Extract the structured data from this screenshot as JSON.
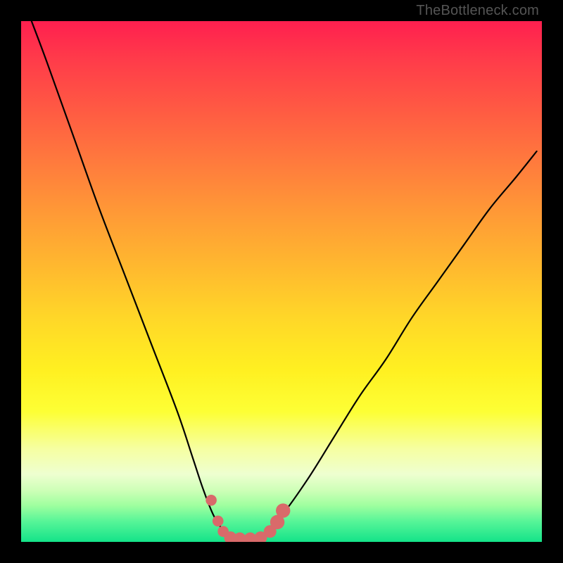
{
  "watermark": {
    "text": "TheBottleneck.com"
  },
  "chart_data": {
    "type": "line",
    "title": "",
    "xlabel": "",
    "ylabel": "",
    "xlim": [
      0,
      100
    ],
    "ylim": [
      0,
      100
    ],
    "grid": false,
    "legend": false,
    "series": [
      {
        "name": "bottleneck-curve",
        "x": [
          2,
          5,
          10,
          15,
          20,
          25,
          30,
          33,
          35,
          37,
          39,
          41,
          43,
          45,
          47,
          50,
          55,
          60,
          65,
          70,
          75,
          80,
          85,
          90,
          95,
          99
        ],
        "values": [
          100,
          92,
          78,
          64,
          51,
          38,
          25,
          16,
          10,
          5,
          2,
          0.5,
          0.5,
          0.5,
          2,
          5,
          12,
          20,
          28,
          35,
          43,
          50,
          57,
          64,
          70,
          75
        ]
      }
    ],
    "markers": {
      "name": "flat-bottom-dots",
      "color": "#d96a6a",
      "points": [
        {
          "x": 36.5,
          "y": 8.0,
          "r": 1.3
        },
        {
          "x": 37.8,
          "y": 4.0,
          "r": 1.3
        },
        {
          "x": 38.8,
          "y": 2.0,
          "r": 1.3
        },
        {
          "x": 40.2,
          "y": 0.8,
          "r": 1.5
        },
        {
          "x": 42.0,
          "y": 0.6,
          "r": 1.5
        },
        {
          "x": 44.0,
          "y": 0.6,
          "r": 1.5
        },
        {
          "x": 46.0,
          "y": 0.8,
          "r": 1.5
        },
        {
          "x": 47.8,
          "y": 2.0,
          "r": 1.5
        },
        {
          "x": 49.2,
          "y": 3.8,
          "r": 1.7
        },
        {
          "x": 50.3,
          "y": 6.0,
          "r": 1.7
        }
      ]
    },
    "background_gradient": {
      "top": "#ff1f4f",
      "mid": "#fff021",
      "bottom": "#14e389"
    }
  }
}
